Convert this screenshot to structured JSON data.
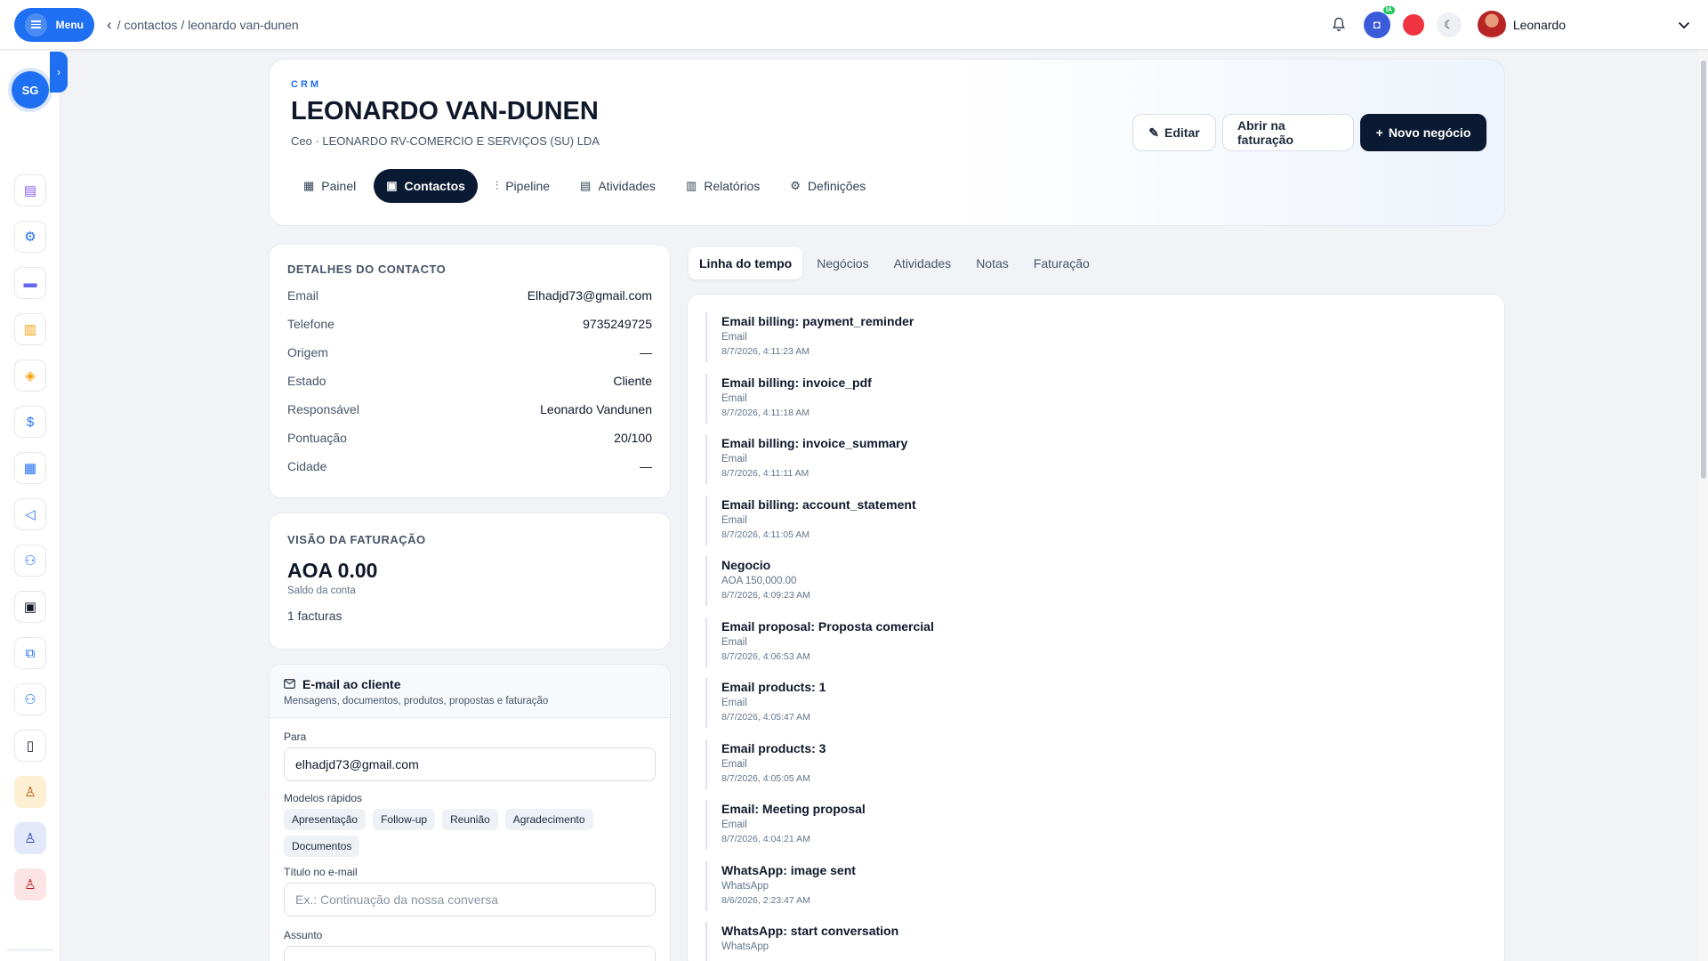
{
  "topbar": {
    "menu_label": "Menu",
    "breadcrumb": [
      "/ contactos",
      "/ leonardo van-dunen"
    ],
    "ia_badge": "IA",
    "user_name": "Leonardo"
  },
  "sidebar": {
    "workspace_initials": "SG",
    "items": [
      {
        "icon": "document-icon",
        "color": "#8b5cf6"
      },
      {
        "icon": "gear-icon",
        "color": "#1f6ff2"
      },
      {
        "icon": "card-icon",
        "color": "#6366f1"
      },
      {
        "icon": "books-icon",
        "color": "#f59e0b"
      },
      {
        "icon": "box-icon",
        "color": "#f59e0b"
      },
      {
        "icon": "dollar-icon",
        "color": "#1f6ff2"
      },
      {
        "icon": "store-icon",
        "color": "#1f6ff2"
      },
      {
        "icon": "megaphone-icon",
        "color": "#1f6ff2"
      },
      {
        "icon": "team-icon",
        "color": "#1f6ff2"
      },
      {
        "icon": "truck-icon",
        "color": "#0f172a"
      },
      {
        "icon": "translate-icon",
        "color": "#1f6ff2"
      },
      {
        "icon": "users-icon",
        "color": "#1f6ff2"
      },
      {
        "icon": "book-icon",
        "color": "#0f172a"
      },
      {
        "icon": "user-yellow-icon",
        "color": "#b45309",
        "bg": "#fdf0d2"
      },
      {
        "icon": "user-blue-icon",
        "color": "#1e40af",
        "bg": "#e3e9fb"
      },
      {
        "icon": "user-red-icon",
        "color": "#b91c1c",
        "bg": "#fde4e4"
      }
    ]
  },
  "header": {
    "eyebrow": "CRM",
    "title": "LEONARDO VAN-DUNEN",
    "subtitle": "Ceo · LEONARDO RV-COMERCIO E SERVIÇOS (SU) LDA",
    "buttons": {
      "edit": "Editar",
      "billing": "Abrir na faturação",
      "new_deal": "Novo negócio"
    },
    "tabs": [
      "Painel",
      "Contactos",
      "Pipeline",
      "Atividades",
      "Relatórios",
      "Definições"
    ]
  },
  "details": {
    "title": "DETALHES DO CONTACTO",
    "rows": [
      {
        "k": "Email",
        "v": "Elhadjd73@gmail.com"
      },
      {
        "k": "Telefone",
        "v": "9735249725"
      },
      {
        "k": "Origem",
        "v": "—"
      },
      {
        "k": "Estado",
        "v": "Cliente"
      },
      {
        "k": "Responsável",
        "v": "Leonardo Vandunen"
      },
      {
        "k": "Pontuação",
        "v": "20/100"
      },
      {
        "k": "Cidade",
        "v": "—"
      }
    ]
  },
  "billing": {
    "title": "VISÃO DA FATURAÇÃO",
    "amount": "AOA 0.00",
    "amount_caption": "Saldo da conta",
    "invoices": "1 facturas"
  },
  "email": {
    "title": "E-mail ao cliente",
    "subtitle": "Mensagens, documentos, produtos, propostas e faturação",
    "to_label": "Para",
    "to_value": "elhadjd73@gmail.com",
    "templates_label": "Modelos rápidos",
    "templates": [
      "Apresentação",
      "Follow-up",
      "Reunião",
      "Agradecimento",
      "Documentos"
    ],
    "subject_title_label": "Título no e-mail",
    "subject_title_placeholder": "Ex.: Continuação da nossa conversa",
    "subject_label": "Assunto"
  },
  "subtabs": [
    "Linha do tempo",
    "Negócios",
    "Atividades",
    "Notas",
    "Faturação"
  ],
  "timeline": [
    {
      "title": "Email billing: payment_reminder",
      "type": "Email",
      "time": "8/7/2026, 4:11:23 AM"
    },
    {
      "title": "Email billing: invoice_pdf",
      "type": "Email",
      "time": "8/7/2026, 4:11:18 AM"
    },
    {
      "title": "Email billing: invoice_summary",
      "type": "Email",
      "time": "8/7/2026, 4:11:11 AM"
    },
    {
      "title": "Email billing: account_statement",
      "type": "Email",
      "time": "8/7/2026, 4:11:05 AM"
    },
    {
      "title": "Negocio",
      "type": "AOA 150,000.00",
      "time": "8/7/2026, 4:09:23 AM"
    },
    {
      "title": "Email proposal: Proposta comercial",
      "type": "Email",
      "time": "8/7/2026, 4:06:53 AM"
    },
    {
      "title": "Email products: 1",
      "type": "Email",
      "time": "8/7/2026, 4:05:47 AM"
    },
    {
      "title": "Email products: 3",
      "type": "Email",
      "time": "8/7/2026, 4:05:05 AM"
    },
    {
      "title": "Email: Meeting proposal",
      "type": "Email",
      "time": "8/7/2026, 4:04:21 AM"
    },
    {
      "title": "WhatsApp: image sent",
      "type": "WhatsApp",
      "time": "8/6/2026, 2:23:47 AM"
    },
    {
      "title": "WhatsApp: start conversation",
      "type": "WhatsApp",
      "time": ""
    }
  ]
}
